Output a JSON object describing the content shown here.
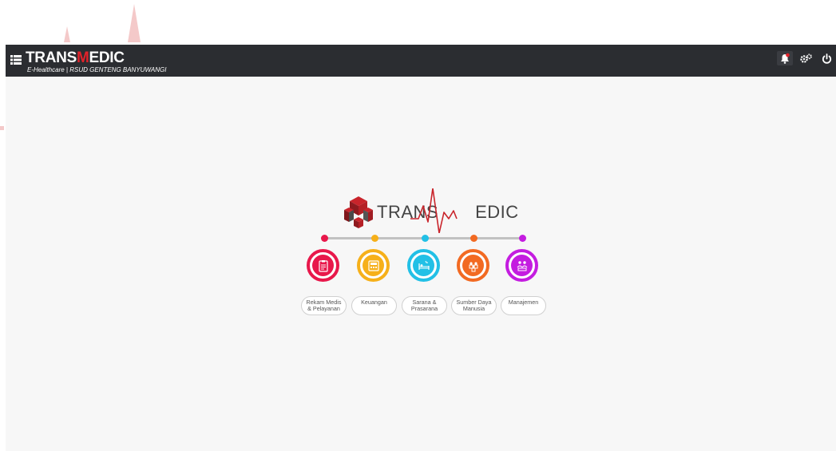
{
  "header": {
    "brand_pre": "TRANS",
    "brand_m": "M",
    "brand_post": "EDIC",
    "subtitle": "E-Healthcare | RSUD GENTENG BANYUWANGI",
    "icons": [
      "menu-list-icon",
      "notification-bell-icon",
      "settings-cogs-icon",
      "power-icon"
    ]
  },
  "logo": {
    "text_left": "TRANS",
    "text_right": "EDIC"
  },
  "modules": [
    {
      "label": "Rekam Medis\n& Pelayanan",
      "color": "#e8184b",
      "icon": "clipboard-icon"
    },
    {
      "label": "Keuangan",
      "color": "#f6b01a",
      "icon": "calculator-icon"
    },
    {
      "label": "Sarana &\nPrasarana",
      "color": "#22c0e6",
      "icon": "hospital-bed-icon"
    },
    {
      "label": "Sumber Daya\nManusia",
      "color": "#f26a22",
      "icon": "people-group-icon"
    },
    {
      "label": "Manajemen",
      "color": "#c41de0",
      "icon": "team-meeting-icon"
    }
  ],
  "colors": {
    "topbar": "#2b2d31",
    "accent_red": "#e2222a"
  }
}
